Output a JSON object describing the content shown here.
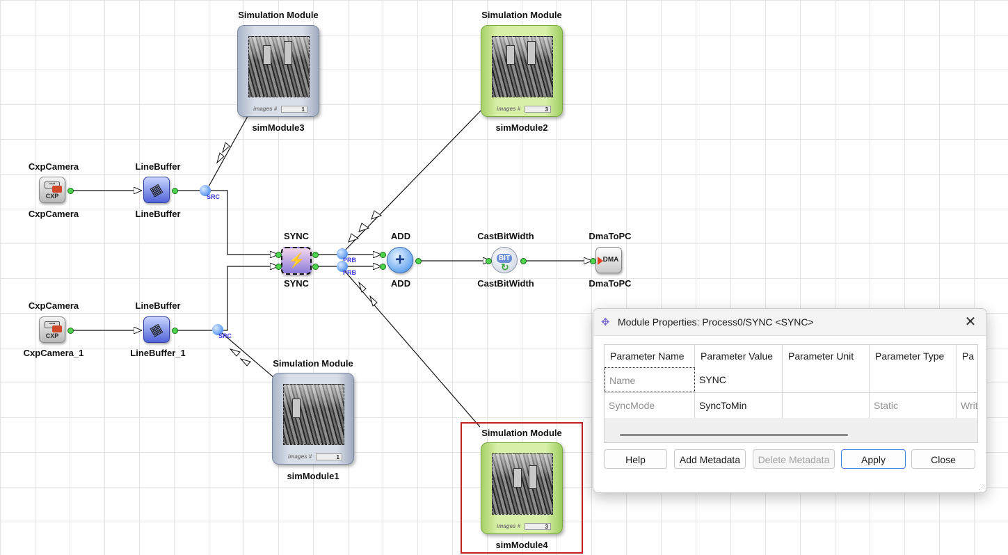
{
  "canvas": {
    "modules": {
      "cam1": {
        "title": "CxpCamera",
        "name": "CxpCamera",
        "icon_text": "CXP"
      },
      "cam2": {
        "title": "CxpCamera",
        "name": "CxpCamera_1",
        "icon_text": "CXP"
      },
      "lb1": {
        "title": "LineBuffer",
        "name": "LineBuffer"
      },
      "lb2": {
        "title": "LineBuffer",
        "name": "LineBuffer_1"
      },
      "sync": {
        "title": "SYNC",
        "name": "SYNC"
      },
      "add": {
        "title": "ADD",
        "name": "ADD",
        "icon_text": "+"
      },
      "cast": {
        "title": "CastBitWidth",
        "name": "CastBitWidth",
        "icon_text": "BIT"
      },
      "dma": {
        "title": "DmaToPC",
        "name": "DmaToPC",
        "icon_text": "DMA"
      },
      "sim3": {
        "title": "Simulation Module",
        "name": "simModule3",
        "images_label": "images #",
        "images_count": "1",
        "color": "#a8b4c8"
      },
      "sim2": {
        "title": "Simulation Module",
        "name": "simModule2",
        "images_label": "images #",
        "images_count": "3",
        "color": "#c4e48c"
      },
      "sim1": {
        "title": "Simulation Module",
        "name": "simModule1",
        "images_label": "images #",
        "images_count": "1",
        "color": "#a8b4c8"
      },
      "sim4": {
        "title": "Simulation Module",
        "name": "simModule4",
        "images_label": "images #",
        "images_count": "3",
        "color": "#c4e48c"
      }
    },
    "port_tags": {
      "src1": "SRC",
      "src2": "SRC",
      "prb1": "PRB",
      "prb2": "PRB"
    },
    "selection_color": "#c02020"
  },
  "dialog": {
    "title": "Module Properties: Process0/SYNC <SYNC>",
    "close_glyph": "✕",
    "columns": [
      "Parameter Name",
      "Parameter Value",
      "Parameter Unit",
      "Parameter Type",
      "Pa"
    ],
    "rows": [
      {
        "name": "Name",
        "value": "SYNC",
        "unit": "",
        "type": "",
        "access": ""
      },
      {
        "name": "SyncMode",
        "value": "SyncToMin",
        "unit": "",
        "type": "Static",
        "access": "Writ"
      }
    ],
    "buttons": {
      "help": "Help",
      "add_metadata": "Add Metadata",
      "delete_metadata": "Delete Metadata",
      "apply": "Apply",
      "close": "Close"
    }
  }
}
